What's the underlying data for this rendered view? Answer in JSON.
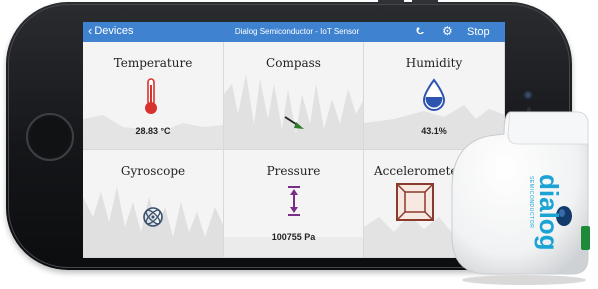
{
  "navbar": {
    "back_label": "Devices",
    "title": "Dialog Semiconductor - IoT Sensor",
    "stop_label": "Stop",
    "icons": [
      "back-chevron-icon",
      "magnet-icon",
      "gear-icon"
    ]
  },
  "tiles": {
    "temperature": {
      "label": "Temperature",
      "value": "28.83 °C",
      "icon": "thermometer-icon",
      "color": "#d8322e"
    },
    "compass": {
      "label": "Compass",
      "icon": "compass-needle-icon",
      "color": "#2f7a2f"
    },
    "humidity": {
      "label": "Humidity",
      "value": "43.1%",
      "icon": "water-drop-icon",
      "color": "#2d55b0"
    },
    "gyroscope": {
      "label": "Gyroscope",
      "icon": "gyroscope-icon",
      "color": "#37506e"
    },
    "pressure": {
      "label": "Pressure",
      "value": "100755 Pa",
      "icon": "pressure-arrow-icon",
      "color": "#7a2d87"
    },
    "accelerometer": {
      "label": "Acceleromete",
      "icon": "accelerometer-cube-icon",
      "color": "#8a3b2c"
    }
  },
  "sensor_device": {
    "brand": "dialog",
    "subtext": "SEMICONDUCTOR",
    "brand_color": "#1aa3d4"
  },
  "colors": {
    "navbar": "#3e82d0",
    "phone_body": "#151619",
    "screen_bg": "#f3f3f3"
  }
}
